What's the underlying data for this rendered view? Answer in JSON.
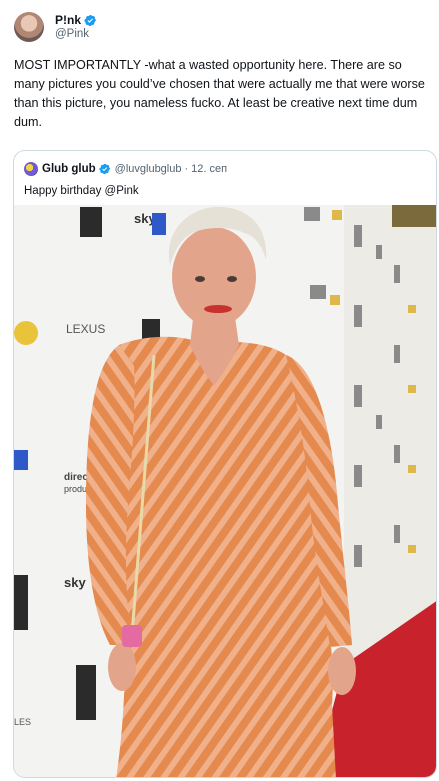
{
  "tweet": {
    "display_name": "P!nk",
    "handle": "@Pink",
    "avatar_icon": "profile-avatar",
    "verified_icon": "verified-badge-icon",
    "text": "MOST IMPORTANTLY -what a wasted opportunity here. There are so many pictures you could’ve chosen that were actually me that were worse than this picture, you nameless fucko. At least be creative next time dum dum."
  },
  "quote": {
    "display_name": "Glub glub",
    "handle": "@luvglubglub",
    "separator": "·",
    "date": "12. сеп",
    "text": "Happy birthday @Pink",
    "verified_icon": "verified-badge-icon"
  },
  "photo": {
    "backdrop_logos": [
      "sky arts",
      "LEXUS",
      "directors productions",
      "sky"
    ],
    "colors": {
      "backdrop": "#f3f3f1",
      "carpet": "#c8232c",
      "dress_base": "#e58a4e",
      "dress_stripe": "#f0b08a",
      "hair": "#e6e1d7",
      "skin": "#e2a58c"
    }
  },
  "colors": {
    "verified": "#1d9bf0",
    "text": "#0f1419",
    "secondary": "#536471",
    "border": "#cfd9de"
  }
}
